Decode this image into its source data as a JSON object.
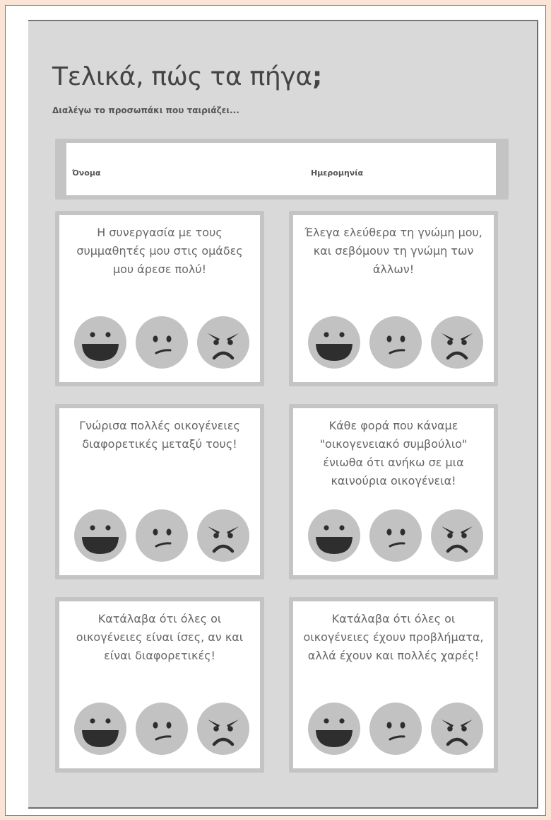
{
  "title": "Τελικά, πώς τα πήγα",
  "title_mark": ";",
  "subtitle": "Διαλέγω το προσωπάκι που ταιριάζει...",
  "fields": {
    "name_label": "Όνομα",
    "date_label": "Ημερομηνία"
  },
  "cards": [
    {
      "text": "Η συνεργασία με τους συμμαθητές μου στις ομάδες μου άρεσε πολύ!"
    },
    {
      "text": "Έλεγα ελεύθερα τη γνώμη μου, και σεβόμουν τη γνώμη των άλλων!"
    },
    {
      "text": "Γνώρισα πολλές οικογένειες διαφορετικές μεταξύ τους!"
    },
    {
      "text": "Κάθε φορά που κάναμε \"οικογενειακό συμβούλιο\" ένιωθα ότι ανήκω σε μια καινούρια οικογένεια!"
    },
    {
      "text": "Κατάλαβα ότι όλες οι οικογένειες είναι ίσες, αν και είναι διαφορετικές!"
    },
    {
      "text": "Κατάλαβα ότι όλες οι οικογένειες έχουν προβλήματα, αλλά έχουν και πολλές χαρές!"
    }
  ],
  "faces": [
    "happy-face-icon",
    "neutral-face-icon",
    "angry-face-icon"
  ],
  "colors": {
    "background": "#f9e4d6",
    "sheet": "#d9d9d9",
    "card_border": "#c4c4c4",
    "face": "#c2c2c2",
    "face_features": "#2e2e2e"
  }
}
